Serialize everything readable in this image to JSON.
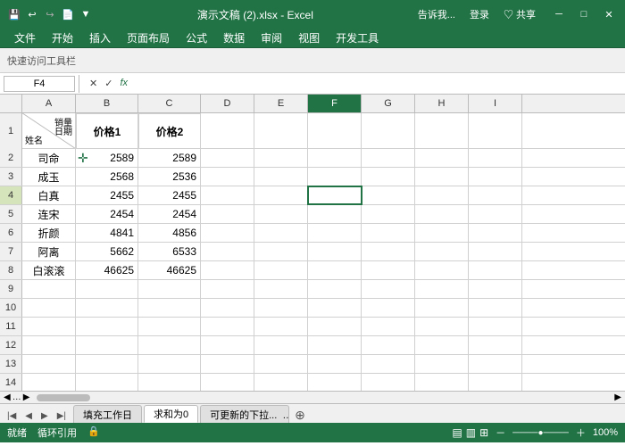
{
  "titlebar": {
    "title": "演示文稿 (2).xlsx - Excel",
    "save_icon": "💾",
    "undo_icon": "↩",
    "redo_icon": "↪",
    "file_icon": "📄",
    "dropdown_icon": "▼",
    "minimize": "─",
    "restore": "□",
    "close": "✕",
    "tell_me": "告诉我...",
    "login": "登录",
    "share": "♡ 共享"
  },
  "menubar": {
    "items": [
      "文件",
      "开始",
      "插入",
      "页面布局",
      "公式",
      "数据",
      "审阅",
      "视图",
      "开发工具"
    ]
  },
  "formula_bar": {
    "cell_ref": "F4",
    "cancel": "✕",
    "confirm": "✓",
    "fx": "fx"
  },
  "columns": [
    "A",
    "B",
    "C",
    "D",
    "E",
    "F",
    "G",
    "H",
    "I"
  ],
  "header": {
    "diag_top": "销量",
    "diag_mid": "日期",
    "diag_bottom": "姓名",
    "col_b": "价格1",
    "col_c": "价格2"
  },
  "rows": [
    {
      "num": "1",
      "a": "",
      "b": "价格1",
      "c": "价格2"
    },
    {
      "num": "2",
      "a": "司命",
      "b": "2589",
      "c": "2589"
    },
    {
      "num": "3",
      "a": "成玉",
      "b": "2568",
      "c": "2536"
    },
    {
      "num": "4",
      "a": "白真",
      "b": "2455",
      "c": "2455"
    },
    {
      "num": "5",
      "a": "连宋",
      "b": "2454",
      "c": "2454"
    },
    {
      "num": "6",
      "a": "折颜",
      "b": "4841",
      "c": "4856"
    },
    {
      "num": "7",
      "a": "阿离",
      "b": "5662",
      "c": "6533"
    },
    {
      "num": "8",
      "a": "白滚滚",
      "b": "46625",
      "c": "46625"
    },
    {
      "num": "9",
      "a": "",
      "b": "",
      "c": ""
    },
    {
      "num": "10",
      "a": "",
      "b": "",
      "c": ""
    },
    {
      "num": "11",
      "a": "",
      "b": "",
      "c": ""
    },
    {
      "num": "12",
      "a": "",
      "b": "",
      "c": ""
    },
    {
      "num": "13",
      "a": "",
      "b": "",
      "c": ""
    },
    {
      "num": "14",
      "a": "",
      "b": "",
      "c": ""
    }
  ],
  "tabs": {
    "sheets": [
      "填充工作日",
      "求和为0",
      "可更新的下拉..."
    ],
    "active": 1
  },
  "statusbar": {
    "left": [
      "就绪",
      "循环引用"
    ],
    "zoom": "100%"
  },
  "active_cell": "F4"
}
